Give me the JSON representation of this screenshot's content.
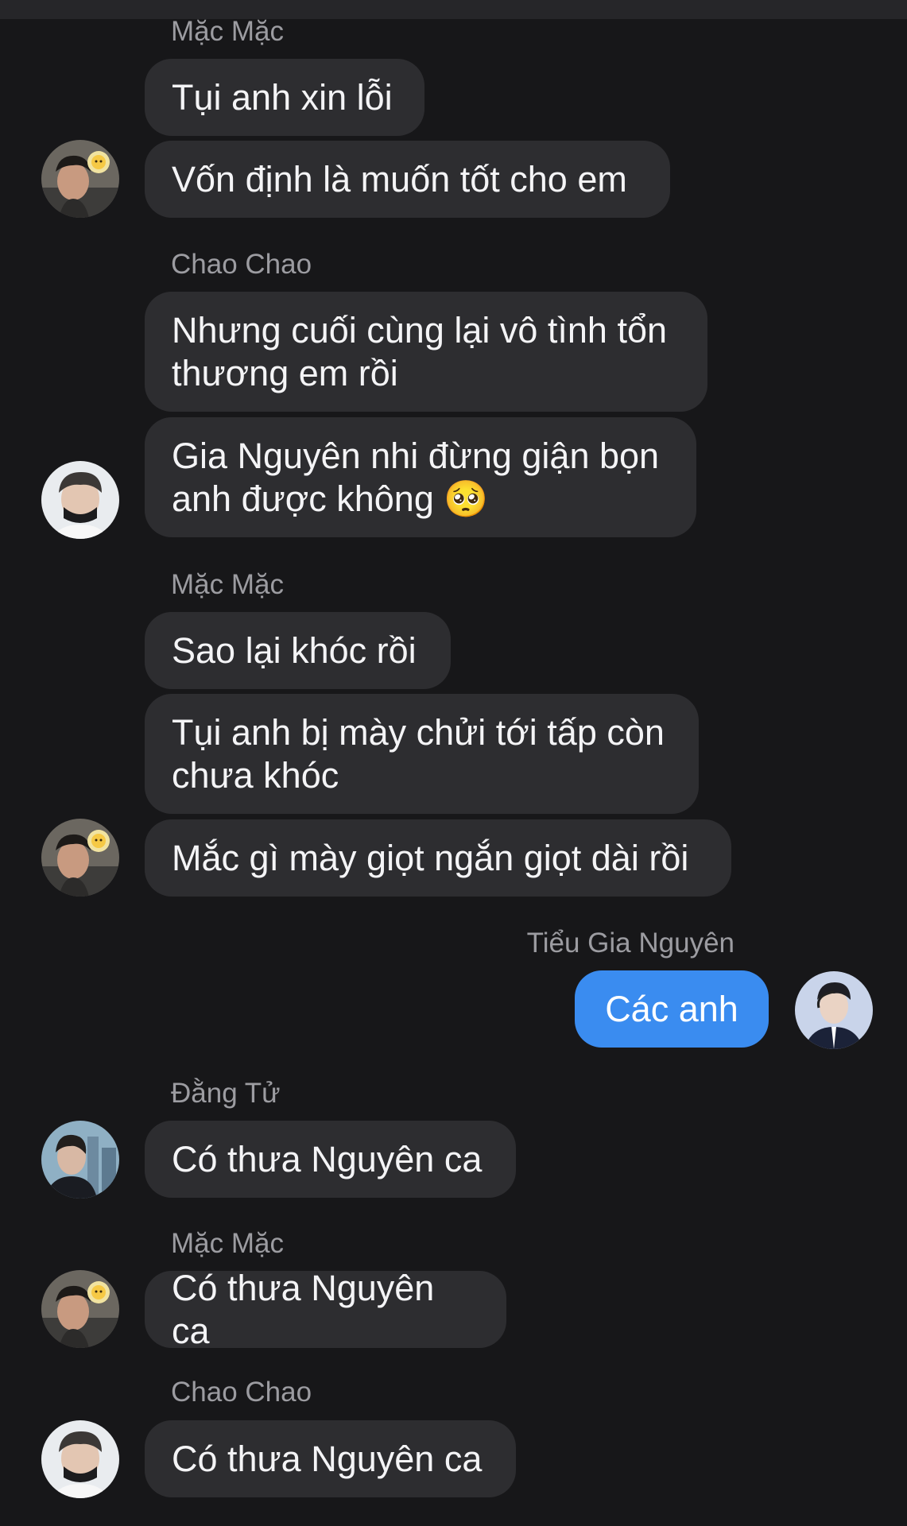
{
  "conversation": {
    "messages": [
      {
        "sender": "Mặc Mặc",
        "text": "Tụi anh xin lỗi"
      },
      {
        "text": "Vốn định là muốn tốt cho em"
      },
      {
        "sender": "Chao Chao",
        "text": "Nhưng cuối cùng lại vô tình tổn thương em rồi"
      },
      {
        "text": "Gia Nguyên nhi đừng giận bọn anh được không 🥺"
      },
      {
        "sender": "Mặc Mặc",
        "text": "Sao lại khóc rồi"
      },
      {
        "text": "Tụi anh bị mày chửi tới tấp còn chưa khóc"
      },
      {
        "text": "Mắc gì mày giọt ngắn giọt dài rồi"
      },
      {
        "sender": "Tiểu Gia Nguyên",
        "text": "Các anh",
        "outgoing": true
      },
      {
        "sender": "Đằng Tử",
        "text": "Có thưa Nguyên ca"
      },
      {
        "sender": "Mặc Mặc",
        "text": "Có thưa Nguyên ca"
      },
      {
        "sender": "Chao Chao",
        "text": "Có thưa Nguyên ca"
      }
    ],
    "avatars": [
      {
        "person": "Mặc Mặc",
        "icon": "person-with-sun-sticker"
      },
      {
        "person": "Chao Chao",
        "icon": "person-with-mask"
      },
      {
        "person": "Mặc Mặc",
        "icon": "person-with-sun-sticker"
      },
      {
        "person": "Tiểu Gia Nguyên",
        "icon": "person-with-headset"
      },
      {
        "person": "Đằng Tử",
        "icon": "person-city-background"
      },
      {
        "person": "Mặc Mặc",
        "icon": "person-with-sun-sticker"
      },
      {
        "person": "Chao Chao",
        "icon": "person-with-mask"
      }
    ]
  },
  "colors": {
    "background": "#171719",
    "incoming_bubble": "#2d2d30",
    "outgoing_bubble": "#3a8cf0",
    "sender_name": "#9c9ca1",
    "message_text": "#f4f4f6"
  }
}
